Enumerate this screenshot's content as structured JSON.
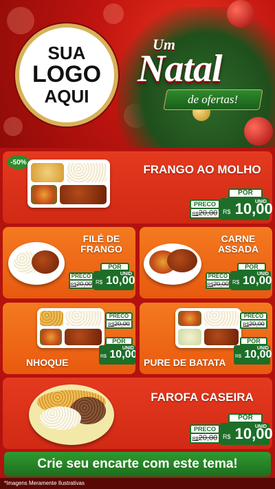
{
  "header": {
    "logo_line1": "SUA",
    "logo_line2": "LOGO",
    "logo_line3": "AQUI",
    "tagline_um": "Um",
    "tagline_natal": "Natal",
    "tagline_ofertas": "de ofertas!"
  },
  "products": [
    {
      "name": "FRANGO AO MOLHO",
      "badge": "-50%",
      "preco_label": "PRECO",
      "old_price": "20,00",
      "old_currency": "R$",
      "por_label": "POR",
      "currency": "R$",
      "price": "10,00",
      "unit": "UNID"
    },
    {
      "name_line1": "FILÉ DE",
      "name_line2": "FRANGO",
      "preco_label": "PRECO",
      "old_price": "20,00",
      "old_currency": "R$",
      "por_label": "POR",
      "currency": "R$",
      "price": "10,00",
      "unit": "UNID"
    },
    {
      "name_line1": "CARNE",
      "name_line2": "ASSADA",
      "preco_label": "PRECO",
      "old_price": "20,00",
      "old_currency": "R$",
      "por_label": "POR",
      "currency": "R$",
      "price": "10,00",
      "unit": "UNID"
    },
    {
      "name": "NHOQUE",
      "preco_label": "PRECO",
      "old_price": "20,00",
      "old_currency": "R$",
      "por_label": "POR",
      "currency": "R$",
      "price": "10,00",
      "unit": "UNID"
    },
    {
      "name": "PURE DE BATATA",
      "preco_label": "PRECO",
      "old_price": "20,00",
      "old_currency": "R$",
      "por_label": "POR",
      "currency": "R$",
      "price": "10,00",
      "unit": "UNID"
    },
    {
      "name": "FAROFA CASEIRA",
      "preco_label": "PRECO",
      "old_price": "20,00",
      "old_currency": "R$",
      "por_label": "POR",
      "currency": "R$",
      "price": "10,00",
      "unit": "UNID"
    }
  ],
  "cta": {
    "label": "Crie seu encarte com este tema!"
  },
  "footer": {
    "disclaimer": "*Imagens Meramente Ilustrativas"
  },
  "colors": {
    "brand_red": "#c0140f",
    "card_orange": "#f47a1f",
    "price_green": "#1c6e28",
    "gold": "#d7b25a"
  }
}
